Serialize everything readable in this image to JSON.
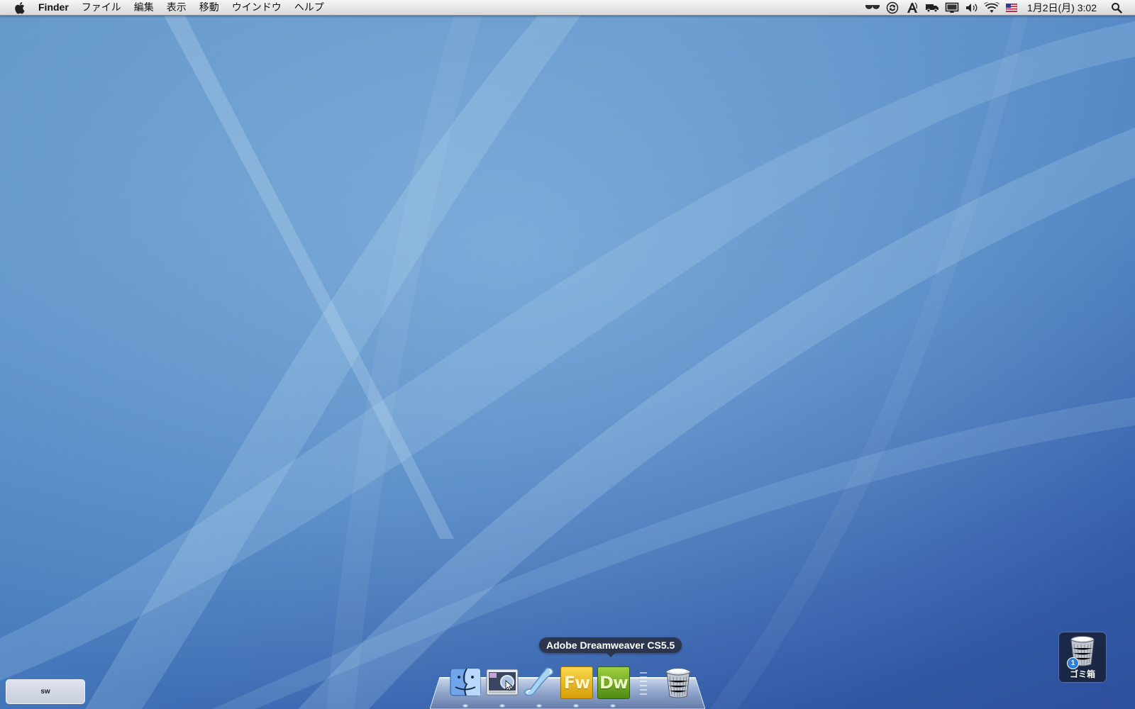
{
  "menubar": {
    "apple_icon": "apple-logo-icon",
    "app_name": "Finder",
    "menus": [
      "ファイル",
      "編集",
      "表示",
      "移動",
      "ウインドウ",
      "ヘルプ"
    ],
    "status_icons": [
      "glasses-icon",
      "sync-icon",
      "text-input-icon",
      "truck-icon",
      "display-icon",
      "volume-icon",
      "wifi-icon",
      "us-flag-icon"
    ],
    "clock": "1月2日(月)  3:02",
    "spotlight_icon": "spotlight-search-icon"
  },
  "dock": {
    "tooltip": "Adobe Dreamweaver CS5.5",
    "items": [
      {
        "name": "Finder",
        "icon": "finder-icon",
        "running": true
      },
      {
        "name": "Preview",
        "icon": "preview-icon",
        "running": true
      },
      {
        "name": "Script",
        "icon": "script-scroll-icon",
        "running": true
      },
      {
        "name": "Adobe Fireworks",
        "label": "Fw",
        "icon": "fireworks-icon",
        "running": true
      },
      {
        "name": "Adobe Dreamweaver CS5.5",
        "label": "Dw",
        "icon": "dreamweaver-icon",
        "running": true
      },
      {
        "name": "ゴミ箱",
        "icon": "trash-icon",
        "running": false
      }
    ]
  },
  "desktop": {
    "trash": {
      "label": "ゴミ箱",
      "badge": "1",
      "icon": "trash-icon"
    },
    "corner_widget": {
      "label": "sw"
    }
  },
  "colors": {
    "wallpaper_light": "#6fa0d4",
    "wallpaper_dark": "#2d4f9c",
    "fireworks_yellow": "#e6b81c",
    "dreamweaver_green": "#6ea925"
  }
}
